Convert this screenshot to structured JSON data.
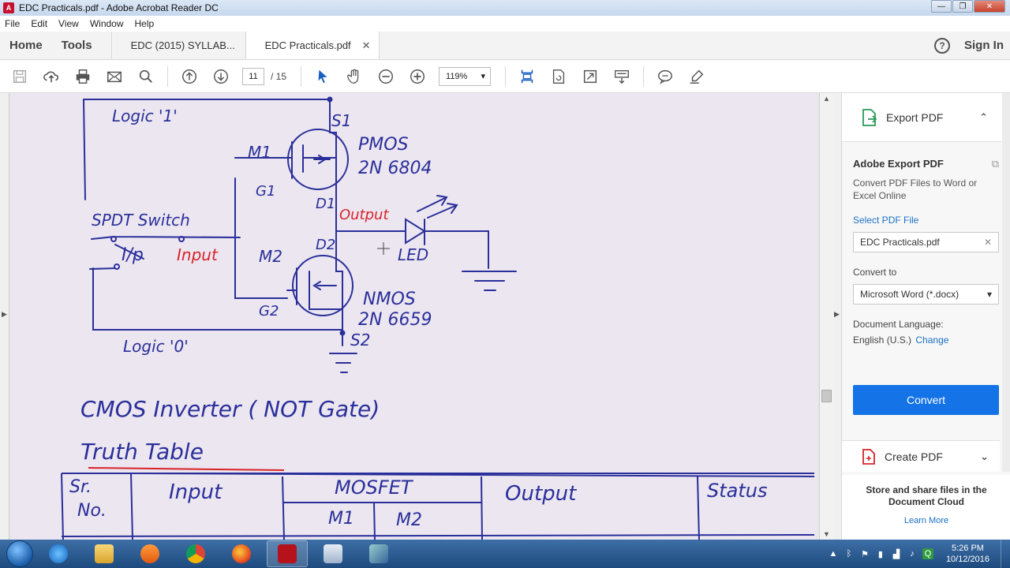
{
  "window": {
    "title": "EDC Practicals.pdf - Adobe Acrobat Reader DC",
    "controls": {
      "minimize": "—",
      "maximize": "❐",
      "close": "✕"
    }
  },
  "menu": [
    "File",
    "Edit",
    "View",
    "Window",
    "Help"
  ],
  "tabs": {
    "home": "Home",
    "tools": "Tools",
    "documents": [
      {
        "label": "EDC (2015) SYLLAB...",
        "active": false
      },
      {
        "label": "EDC Practicals.pdf",
        "active": true
      }
    ],
    "close_glyph": "✕",
    "help_glyph": "?",
    "sign_in": "Sign In"
  },
  "toolbar": {
    "current_page": "11",
    "total_pages": "/ 15",
    "zoom": "119%",
    "zoom_caret": "▾"
  },
  "document": {
    "handwriting": {
      "logic1": "Logic '1'",
      "s1": "S1",
      "m1": "M1",
      "pmos": "PMOS",
      "pmos_part": "2N 6804",
      "g1": "G1",
      "d1": "D1",
      "output": "Output",
      "spdt": "SPDT Switch",
      "ip": "I/p",
      "input": "Input",
      "m2": "M2",
      "d2": "D2",
      "led": "LED",
      "nmos": "NMOS",
      "nmos_part": "2N 6659",
      "g2": "G2",
      "s2": "S2",
      "logic0": "Logic '0'",
      "heading": "CMOS Inverter ( NOT Gate)",
      "truth_table": "Truth Table"
    },
    "table_headers": {
      "sr": "Sr.",
      "no": "No.",
      "input": "Input",
      "mosfet": "MOSFET",
      "m1": "M1",
      "m2": "M2",
      "output": "Output",
      "status": "Status"
    },
    "ink_color": "#2a2f9a",
    "red_ink": "#d8232a"
  },
  "export_panel": {
    "header": "Export PDF",
    "collapse_glyph": "⌃",
    "title": "Adobe Export PDF",
    "description": "Convert PDF Files to Word or Excel Online",
    "select_file": "Select PDF File",
    "file_name": "EDC Practicals.pdf",
    "clear_glyph": "✕",
    "convert_to_label": "Convert to",
    "convert_to_value": "Microsoft Word (*.docx)",
    "dropdown_glyph": "▾",
    "language_label": "Document Language:",
    "language_value": "English (U.S.)",
    "change": "Change",
    "convert_button": "Convert",
    "create_pdf": "Create PDF",
    "expand_glyph": "⌄",
    "store_text": "Store and share files in the Document Cloud",
    "learn_more": "Learn More",
    "button_color": "#1473e6"
  },
  "taskbar": {
    "time": "5:26 PM",
    "date": "10/12/2016"
  }
}
